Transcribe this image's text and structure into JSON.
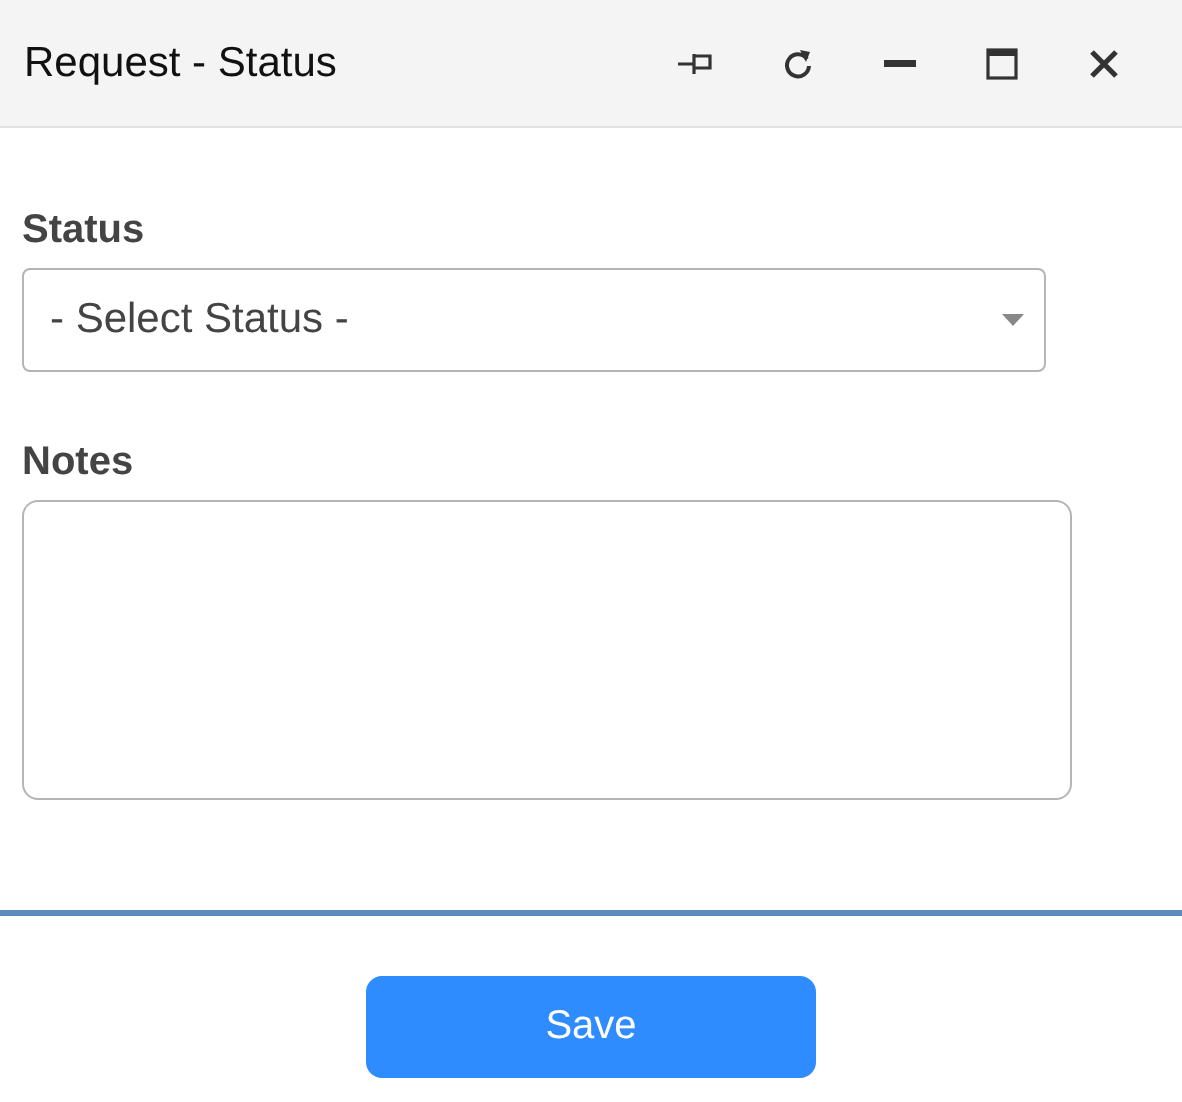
{
  "window": {
    "title": "Request - Status"
  },
  "form": {
    "status_label": "Status",
    "status_select": {
      "value": "- Select Status -"
    },
    "notes_label": "Notes"
  },
  "buttons": [
    "Save"
  ]
}
